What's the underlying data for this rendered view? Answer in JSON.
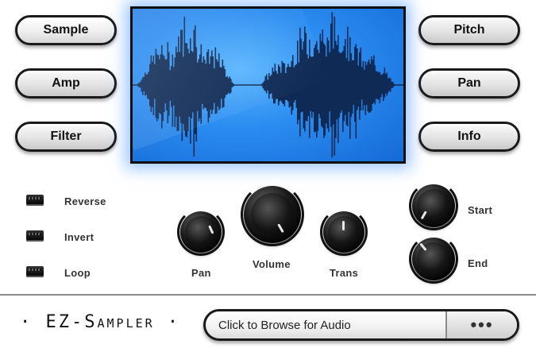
{
  "left_buttons": [
    {
      "label": "Sample",
      "active": true
    },
    {
      "label": "Amp",
      "active": false
    },
    {
      "label": "Filter",
      "active": false
    }
  ],
  "right_buttons": [
    {
      "label": "Pitch"
    },
    {
      "label": "Pan"
    },
    {
      "label": "Info"
    }
  ],
  "toggles": [
    {
      "label": "Reverse"
    },
    {
      "label": "Invert"
    },
    {
      "label": "Loop"
    }
  ],
  "knobs": {
    "pan": {
      "label": "Pan"
    },
    "volume": {
      "label": "Volume"
    },
    "trans": {
      "label": "Trans"
    },
    "start": {
      "label": "Start"
    },
    "end": {
      "label": "End"
    }
  },
  "footer": {
    "logo": "· EZ-Sampler ·",
    "browse_text": "Click to Browse for Audio",
    "browse_button": "•••"
  },
  "colors": {
    "display_blue": "#2a8cf0",
    "waveform": "#0e2a55"
  }
}
